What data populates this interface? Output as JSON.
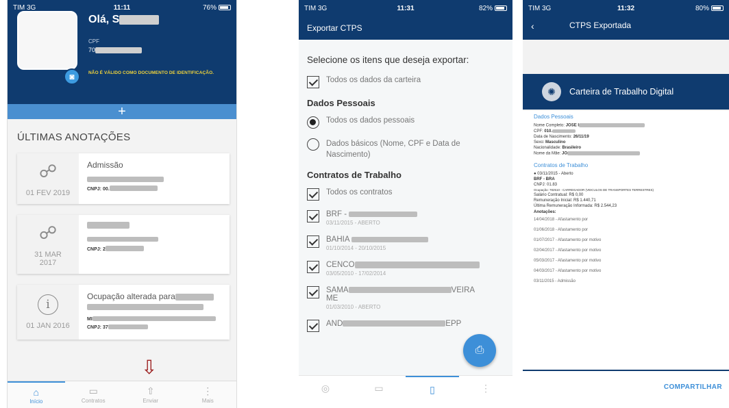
{
  "phone1": {
    "status": {
      "carrier": "TIM  3G",
      "time": "11:11",
      "battery": "76%"
    },
    "greeting": "Olá, S",
    "cpf_label": "CPF",
    "cpf_value": "70",
    "warning": "NÃO É VÁLIDO COMO DOCUMENTO DE IDENTIFICAÇÃO.",
    "plus": "+",
    "section_title": "ÚLTIMAS ANOTAÇÕES",
    "cards": [
      {
        "date": "01 FEV 2019",
        "title": "Admissão",
        "cnpj": "CNPJ: 00."
      },
      {
        "date": "31 MAR 2017",
        "title": "",
        "cnpj": "CNPJ: 2"
      },
      {
        "date": "01 JAN 2016",
        "title": "Ocupação alterada para",
        "mi": "MI",
        "cnpj": "CNPJ: 37"
      }
    ],
    "tabs": [
      "Início",
      "Contratos",
      "Enviar",
      "Mais"
    ]
  },
  "phone2": {
    "status": {
      "carrier": "TIM  3G",
      "time": "11:31",
      "battery": "82%"
    },
    "title": "Exportar CTPS",
    "question": "Selecione os itens que deseja exportar:",
    "all_card": "Todos os dados da carteira",
    "personal_header": "Dados Pessoais",
    "personal_all": "Todos os dados pessoais",
    "personal_basic": "Dados básicos (Nome, CPF e Data de Nascimento)",
    "contracts_header": "Contratos de Trabalho",
    "contracts_all": "Todos os contratos",
    "contracts": [
      {
        "name": "BRF - ",
        "dates": "03/11/2015 - ABERTO"
      },
      {
        "name": "BAHIA ",
        "dates": "01/10/2014 - 20/10/2015"
      },
      {
        "name": "CENCO",
        "dates": "03/05/2010 - 17/02/2014"
      },
      {
        "name": "SAMA",
        "suffix": "VEIRA",
        "name2": "ME",
        "dates": "01/03/2010 - ABERTO"
      },
      {
        "name": "AND",
        "suffix": "EPP",
        "dates": ""
      }
    ],
    "pdf_icon": "pdf-icon"
  },
  "phone3": {
    "status": {
      "carrier": "TIM  3G",
      "time": "11:32",
      "battery": "80%"
    },
    "back": "‹",
    "title": "CTPS Exportada",
    "doc_title": "Carteira de Trabalho Digital",
    "personal_header": "Dados Pessoais",
    "fields": [
      {
        "label": "Nome Completo:",
        "value": "JOSE I"
      },
      {
        "label": "CPF:",
        "value": "010."
      },
      {
        "label": "Data de Nascimento:",
        "value": "26/11/19"
      },
      {
        "label": "Sexo:",
        "value": "Masculino"
      },
      {
        "label": "Nacionalidade:",
        "value": "Brasileiro"
      },
      {
        "label": "Nome da Mãe:",
        "value": "JO"
      }
    ],
    "contracts_header": "Contratos de Trabalho",
    "contract_lines": [
      "● 03/11/2015 - Aberto",
      "BRF - BRA",
      "CNPJ: 01.83",
      "Ocupação: 782510 - CARREGADOR (VEICULOS DE TRANSPORTES TERRESTRES)",
      "Salário Contratual: R$ 0,00",
      "Remuneração Inicial: R$ 1.440,71",
      "Última Remuneração Informada: R$ 2.544,23"
    ],
    "anot_header": "Anotações:",
    "anotations": [
      "14/04/2018 - Afastamento por",
      "01/06/2018 - Afastamento por",
      "01/07/2017 - Afastamento por motivo",
      "02/04/2017 - Afastamento por motivo",
      "05/03/2017 - Afastamento por motivo",
      "04/03/2017 - Afastamento por motivo",
      "03/11/2015 - Admissão"
    ],
    "share": "COMPARTILHAR"
  }
}
